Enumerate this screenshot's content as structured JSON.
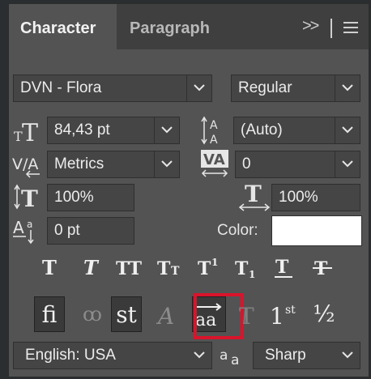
{
  "tabs": {
    "character": "Character",
    "paragraph": "Paragraph",
    "more": ">>"
  },
  "font": {
    "family": "DVN - Flora",
    "style": "Regular"
  },
  "metrics": {
    "size": "84,43 pt",
    "leading": "(Auto)",
    "kerning": "Metrics",
    "tracking": "0",
    "vertical_scale": "100%",
    "horizontal_scale": "100%",
    "baseline_shift": "0 pt",
    "color_label": "Color:",
    "color_value": "#ffffff"
  },
  "type_style_buttons": [
    {
      "name": "faux-bold-button",
      "glyph": "T"
    },
    {
      "name": "faux-italic-button",
      "glyph": "T"
    },
    {
      "name": "all-caps-button",
      "glyph": "TT"
    },
    {
      "name": "small-caps-button",
      "glyph": "Tт"
    },
    {
      "name": "superscript-button",
      "glyph": "T¹"
    },
    {
      "name": "subscript-button",
      "glyph": "T₁"
    },
    {
      "name": "underline-button",
      "glyph": "T"
    },
    {
      "name": "strikethrough-button",
      "glyph": "T"
    }
  ],
  "opentype_buttons": {
    "ligatures": "fi",
    "discretionary": "ꝏ",
    "swash_st": "st",
    "swash_a": "𝒜",
    "stylistic": "aa",
    "titling": "𝕋",
    "ordinals": "1st",
    "fractions": "½"
  },
  "bottom": {
    "language": "English: USA",
    "aa_label": "aa",
    "antialias": "Sharp"
  },
  "colors": {
    "panel": "#535353",
    "highlight": "#d9142b"
  }
}
